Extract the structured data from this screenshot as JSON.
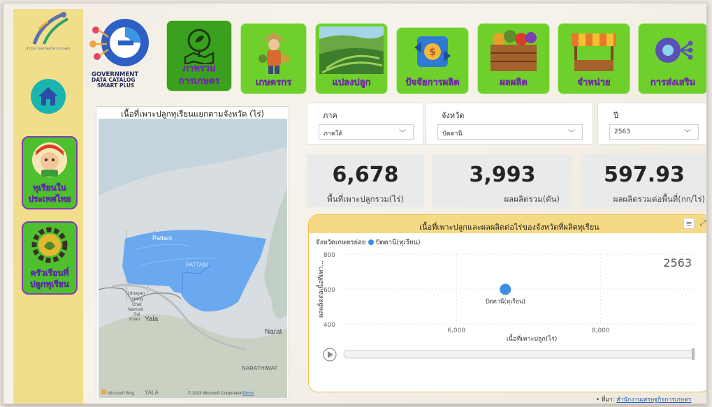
{
  "sidebar": {
    "agency_text": "สำนักงานเศรษฐกิจการเกษตร",
    "cards": [
      {
        "label_line1": "ทุเรียนใน",
        "label_line2": "ประเทศไทย"
      },
      {
        "label_line1": "ครัวเรือนที่",
        "label_line2": "ปลูกทุเรียน"
      }
    ]
  },
  "logo": {
    "line1": "GOVERNMENT",
    "line2": "DATA CATALOG",
    "line3": "SMART PLUS"
  },
  "nav": [
    {
      "label": "ภาพรวม การเกษตร",
      "line1": "ภาพรวม",
      "line2": "การเกษตร",
      "icon": "map-pin-leaf-icon",
      "active": true
    },
    {
      "label": "เกษตรกร",
      "icon": "farmer-icon",
      "active": false
    },
    {
      "label": "แปลงปลูก",
      "icon": "field-icon",
      "active": false
    },
    {
      "label": "ปัจจัยการผลิต",
      "icon": "money-cycle-icon",
      "active": false
    },
    {
      "label": "ผลผลิต",
      "icon": "produce-crate-icon",
      "active": false
    },
    {
      "label": "จำหน่าย",
      "icon": "market-stall-icon",
      "active": false
    },
    {
      "label": "การส่งเสริม",
      "icon": "gear-network-icon",
      "active": false
    }
  ],
  "map": {
    "title": "เนื้อที่เพาะปลูกทุเรียนแยกตามจังหวัด (ไร่)",
    "labels": {
      "pattani_en": "Pattani",
      "pattani_caps": "PATTANI",
      "uthayan": "Uthayan",
      "hong": "Hong",
      "chat": "Chat",
      "namtok": "Namtok",
      "sai": "Sai",
      "khao": "Khao",
      "yala": "Yala",
      "narat": "Narat",
      "narathiwat": "NARATHIWAT",
      "yala_caps": "YALA"
    },
    "bing": "Microsoft Bing",
    "copyright": "© 2023 Microsoft Corporation",
    "terms": "Terms"
  },
  "filters": [
    {
      "label": "ภาค",
      "value": "ภาคใต้"
    },
    {
      "label": "จังหวัด",
      "value": "ปัตตานี"
    },
    {
      "label": "ปี",
      "value": "2563"
    }
  ],
  "kpis": [
    {
      "value": "6,678",
      "label": "พื้นที่เพาะปลูกรวม(ไร่)"
    },
    {
      "value": "3,993",
      "label": "ผลผลิตรวม(ตัน)"
    },
    {
      "value": "597.93",
      "label": "ผลผลิตรวมต่อพื้นที่(กก/ไร่)"
    }
  ],
  "scatter": {
    "title": "เนื้อที่เพาะปลูกและผลผลิตต่อไร่ของจังหวัดที่ผลิตทุเรียน",
    "legend_title": "จังหวัดเกษตรย่อย",
    "year_label": "2563",
    "colors": {
      "point": "#3c8ee6",
      "header": "#f6da83"
    }
  },
  "chart_data": {
    "type": "scatter",
    "title": "เนื้อที่เพาะปลูกและผลผลิตต่อไร่ของจังหวัดที่ผลิตทุเรียน",
    "xlabel": "เนื้อที่เพาะปลูก(ไร่)",
    "ylabel": "ผลผลิตต่อเนื้อที่เพา...",
    "xlim": [
      4400,
      9300
    ],
    "ylim": [
      400,
      800
    ],
    "x_ticks": [
      "6,000",
      "8,000"
    ],
    "y_ticks": [
      "800",
      "600",
      "400"
    ],
    "grid": true,
    "series": [
      {
        "name": "ปัตตานี(ทุเรียน)",
        "points": [
          {
            "x": 6678,
            "y": 598,
            "label": "ปัตตานี(ทุเรียน)"
          }
        ]
      }
    ]
  },
  "source": {
    "prefix": "• ที่มา:",
    "link": "สำนักงานเศรษฐกิจการเกษตร"
  }
}
